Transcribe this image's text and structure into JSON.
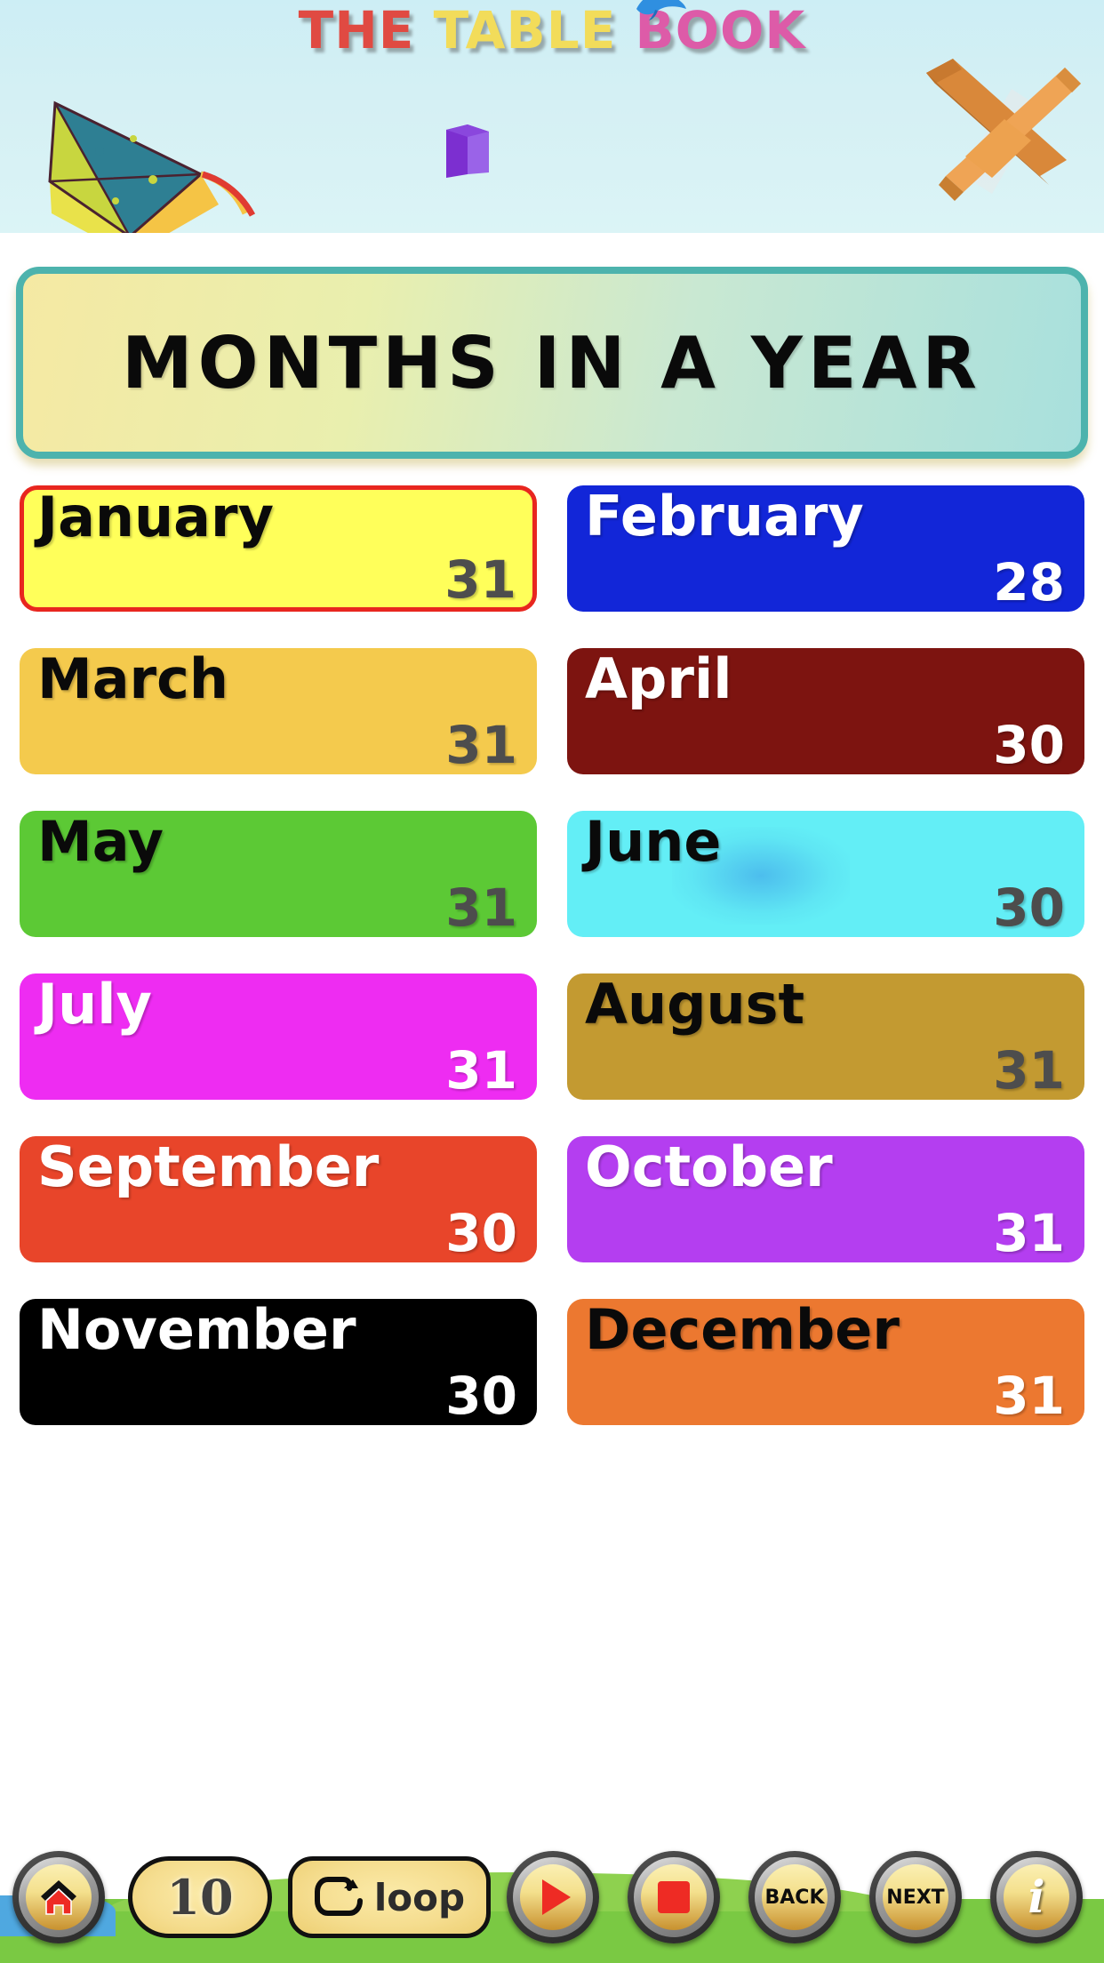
{
  "app": {
    "brand_word1": "THE",
    "brand_word2": "TABLE",
    "brand_word3": "BOOK",
    "brand_color1": "#e04a42",
    "brand_color2": "#f2dc5a",
    "brand_color3": "#dd5ba8"
  },
  "header": {
    "decorations": [
      "kite-icon",
      "bird-icon",
      "multiply-x-icon",
      "purple-block-icon"
    ],
    "background_color": "#d5f0f4"
  },
  "banner": {
    "title": "MONTHS IN A YEAR",
    "border_color": "#4db3ad",
    "gradient_from": "#f5e9a3",
    "gradient_to": "#a8e0dd"
  },
  "months": [
    {
      "name": "January",
      "days": "31",
      "bg": "#ffff5a",
      "name_color": "#0a0a0a",
      "days_color": "#4d4d4d",
      "selected": true,
      "highlight_color": "#e8261f"
    },
    {
      "name": "February",
      "days": "28",
      "bg": "#1226d8",
      "name_color": "#ffffff",
      "days_color": "#ffffff",
      "selected": false
    },
    {
      "name": "March",
      "days": "31",
      "bg": "#f4ca4d",
      "name_color": "#0a0a0a",
      "days_color": "#4d4d4d",
      "selected": false
    },
    {
      "name": "April",
      "days": "30",
      "bg": "#7d1410",
      "name_color": "#ffffff",
      "days_color": "#ffffff",
      "selected": false
    },
    {
      "name": "May",
      "days": "31",
      "bg": "#5cc935",
      "name_color": "#0a0a0a",
      "days_color": "#4d4d4d",
      "selected": false
    },
    {
      "name": "June",
      "days": "30",
      "bg": "#63eef6",
      "name_color": "#0a0a0a",
      "days_color": "#4d4d4d",
      "selected": false,
      "blob": true
    },
    {
      "name": "July",
      "days": "31",
      "bg": "#ee2cf2",
      "name_color": "#ffffff",
      "days_color": "#ffffff",
      "selected": false
    },
    {
      "name": "August",
      "days": "31",
      "bg": "#c39a31",
      "name_color": "#0a0a0a",
      "days_color": "#4d4d4d",
      "selected": false
    },
    {
      "name": "September",
      "days": "30",
      "bg": "#e8452a",
      "name_color": "#ffffff",
      "days_color": "#ffffff",
      "selected": false
    },
    {
      "name": "October",
      "days": "31",
      "bg": "#b43ef0",
      "name_color": "#ffffff",
      "days_color": "#ffffff",
      "selected": false
    },
    {
      "name": "November",
      "days": "30",
      "bg": "#000000",
      "name_color": "#ffffff",
      "days_color": "#ffffff",
      "selected": false
    },
    {
      "name": "December",
      "days": "31",
      "bg": "#ec7830",
      "name_color": "#0a0a0a",
      "days_color": "#ffffff",
      "selected": false
    }
  ],
  "toolbar": {
    "home_icon": "home-icon",
    "counter_value": "10",
    "loop_label": "loop",
    "loop_icon": "loop-arrow-icon",
    "play_icon": "play-icon",
    "stop_icon": "stop-icon",
    "back_label": "BACK",
    "next_label": "NEXT",
    "info_label": "i",
    "grass_color": "#7ac943",
    "water_color": "#4fa8e0"
  }
}
